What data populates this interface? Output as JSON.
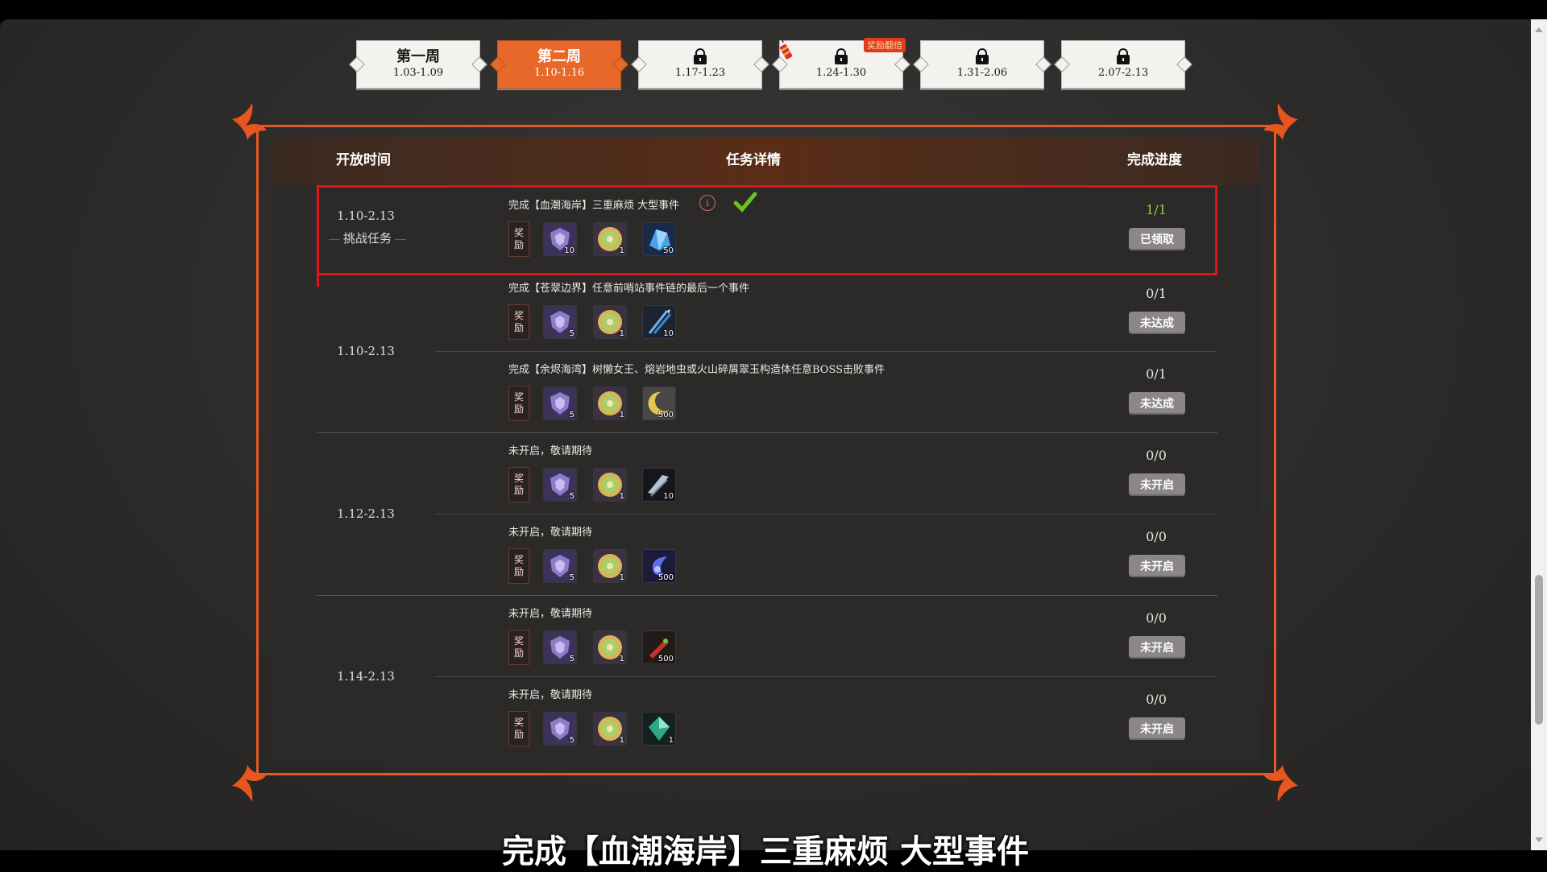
{
  "colors": {
    "accent_orange": "#e8682a",
    "panel_border": "#e45a24",
    "highlight_red": "#e0141b",
    "done_green": "#8fd13c",
    "button_gray": "#8a8786"
  },
  "tabs": [
    {
      "name": "第一周",
      "dates": "1.03-1.09",
      "locked": false,
      "active": false
    },
    {
      "name": "第二周",
      "dates": "1.10-1.16",
      "locked": false,
      "active": true
    },
    {
      "name": "",
      "dates": "1.17-1.23",
      "locked": true,
      "active": false
    },
    {
      "name": "",
      "dates": "1.24-1.30",
      "locked": true,
      "active": false,
      "badge": "奖励翻倍"
    },
    {
      "name": "",
      "dates": "1.31-2.06",
      "locked": true,
      "active": false
    },
    {
      "name": "",
      "dates": "2.07-2.13",
      "locked": true,
      "active": false
    }
  ],
  "headers": {
    "open_time": "开放时间",
    "task_detail": "任务详情",
    "progress": "完成进度"
  },
  "reward_label": "奖励",
  "groups": [
    {
      "date": "1.10-2.13",
      "tag": "挑战任务"
    },
    {
      "date": "1.10-2.13"
    },
    {
      "date": "1.12-2.13"
    },
    {
      "date": "1.14-2.13"
    }
  ],
  "tasks": [
    {
      "desc": "完成【血潮海岸】三重麻烦 大型事件",
      "progress": "1/1",
      "status": "已领取",
      "items": [
        {
          "icon": "purple-shield-icon",
          "qty": "10"
        },
        {
          "icon": "gold-coin-icon",
          "qty": "1"
        },
        {
          "icon": "blue-crystal-icon",
          "qty": "50"
        }
      ]
    },
    {
      "desc": "完成【苍翠边界】任意前哨站事件链的最后一个事件",
      "progress": "0/1",
      "status": "未达成",
      "items": [
        {
          "icon": "purple-shield-icon",
          "qty": "5"
        },
        {
          "icon": "gold-coin-icon",
          "qty": "1"
        },
        {
          "icon": "blue-arrows-icon",
          "qty": "10"
        }
      ]
    },
    {
      "desc": "完成【余烬海湾】树懒女王、熔岩地虫或火山碎屑翠玉构造体任意BOSS击败事件",
      "progress": "0/1",
      "status": "未达成",
      "items": [
        {
          "icon": "purple-shield-icon",
          "qty": "5"
        },
        {
          "icon": "gold-coin-icon",
          "qty": "1"
        },
        {
          "icon": "moon-icon",
          "qty": "500"
        }
      ]
    },
    {
      "desc": "未开启，敬请期待",
      "progress": "0/0",
      "status": "未开启",
      "items": [
        {
          "icon": "purple-shield-icon",
          "qty": "5"
        },
        {
          "icon": "gold-coin-icon",
          "qty": "1"
        },
        {
          "icon": "blade-icon",
          "qty": "10"
        }
      ]
    },
    {
      "desc": "未开启，敬请期待",
      "progress": "0/0",
      "status": "未开启",
      "items": [
        {
          "icon": "purple-shield-icon",
          "qty": "5"
        },
        {
          "icon": "gold-coin-icon",
          "qty": "1"
        },
        {
          "icon": "blue-swirl-icon",
          "qty": "500"
        }
      ]
    },
    {
      "desc": "未开启，敬请期待",
      "progress": "0/0",
      "status": "未开启",
      "items": [
        {
          "icon": "purple-shield-icon",
          "qty": "5"
        },
        {
          "icon": "gold-coin-icon",
          "qty": "1"
        },
        {
          "icon": "red-gem-icon",
          "qty": "500"
        }
      ]
    },
    {
      "desc": "未开启，敬请期待",
      "progress": "0/0",
      "status": "未开启",
      "items": [
        {
          "icon": "purple-shield-icon",
          "qty": "5"
        },
        {
          "icon": "gold-coin-icon",
          "qty": "1"
        },
        {
          "icon": "green-orb-icon",
          "qty": "1"
        }
      ]
    }
  ],
  "subtitle": "完成【血潮海岸】三重麻烦 大型事件"
}
